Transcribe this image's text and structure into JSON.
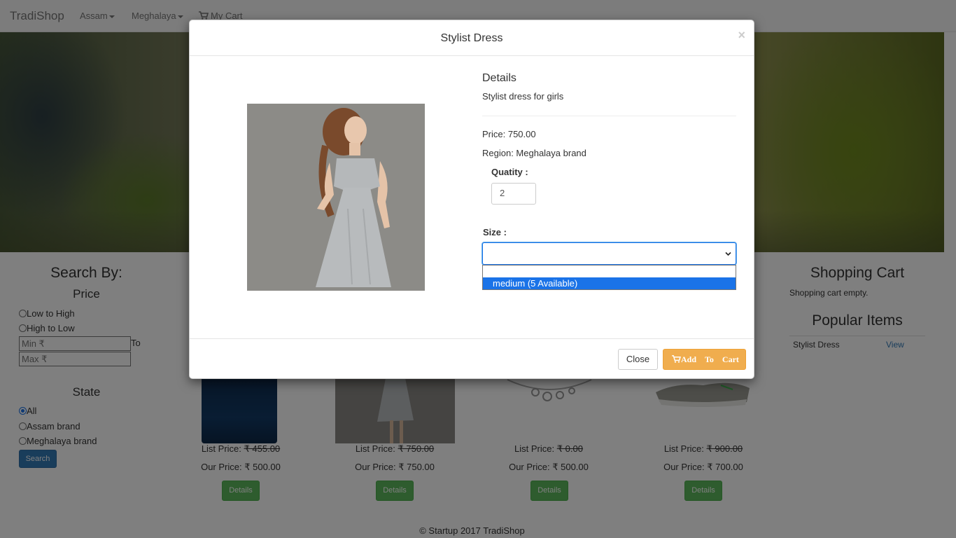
{
  "navbar": {
    "brand": "TradiShop",
    "menu_assam": "Assam",
    "menu_meghalaya": "Meghalaya",
    "my_cart": "My Cart",
    "cart_icon": "shopping-cart-icon"
  },
  "sidebar_left": {
    "title": "Search By:",
    "price_heading": "Price",
    "sort_low_high": "Low to High",
    "sort_high_low": "High to Low",
    "min_placeholder": "Min ₹",
    "max_placeholder": "Max ₹",
    "to_label": "To",
    "state_heading": "State",
    "state_all": "All",
    "state_assam": "Assam brand",
    "state_meghalaya": "Meghalaya brand",
    "selected_state": "All",
    "search_button": "Search"
  },
  "products": [
    {
      "list_label": "List Price:",
      "list_price": "₹ 455.00",
      "our_label": "Our Price:",
      "our_price": "₹ 500.00",
      "details": "Details"
    },
    {
      "list_label": "List Price:",
      "list_price": "₹ 750.00",
      "our_label": "Our Price:",
      "our_price": "₹ 750.00",
      "details": "Details"
    },
    {
      "list_label": "List Price:",
      "list_price": "₹ 0.00",
      "our_label": "Our Price:",
      "our_price": "₹ 500.00",
      "details": "Details"
    },
    {
      "list_label": "List Price:",
      "list_price": "₹ 900.00",
      "our_label": "Our Price:",
      "our_price": "₹ 700.00",
      "details": "Details"
    }
  ],
  "sidebar_right": {
    "cart_title": "Shopping Cart",
    "cart_empty": "Shopping cart empty.",
    "popular_title": "Popular Items",
    "popular_items": [
      {
        "name": "Stylist Dress",
        "action": "View"
      }
    ]
  },
  "footer": {
    "text": "© Startup 2017 TradiShop"
  },
  "modal": {
    "title": "Stylist Dress",
    "close_glyph": "×",
    "details_heading": "Details",
    "description": "Stylist dress for girls",
    "price": "Price: 750.00",
    "region": "Region: Meghalaya brand",
    "quantity_label": "Quatity :",
    "quantity_value": "2",
    "size_label": "Size :",
    "size_selected": "",
    "size_options": [
      "",
      "medium (5 Available)"
    ],
    "highlighted_option": "medium (5 Available)",
    "close_button": "Close",
    "add_word": "Add",
    "to_word": "To",
    "cart_word": "Cart"
  },
  "colors": {
    "primary": "#337ab7",
    "success": "#5cb85c",
    "warning": "#f0ad4e",
    "select_focus": "#1a73e8"
  }
}
